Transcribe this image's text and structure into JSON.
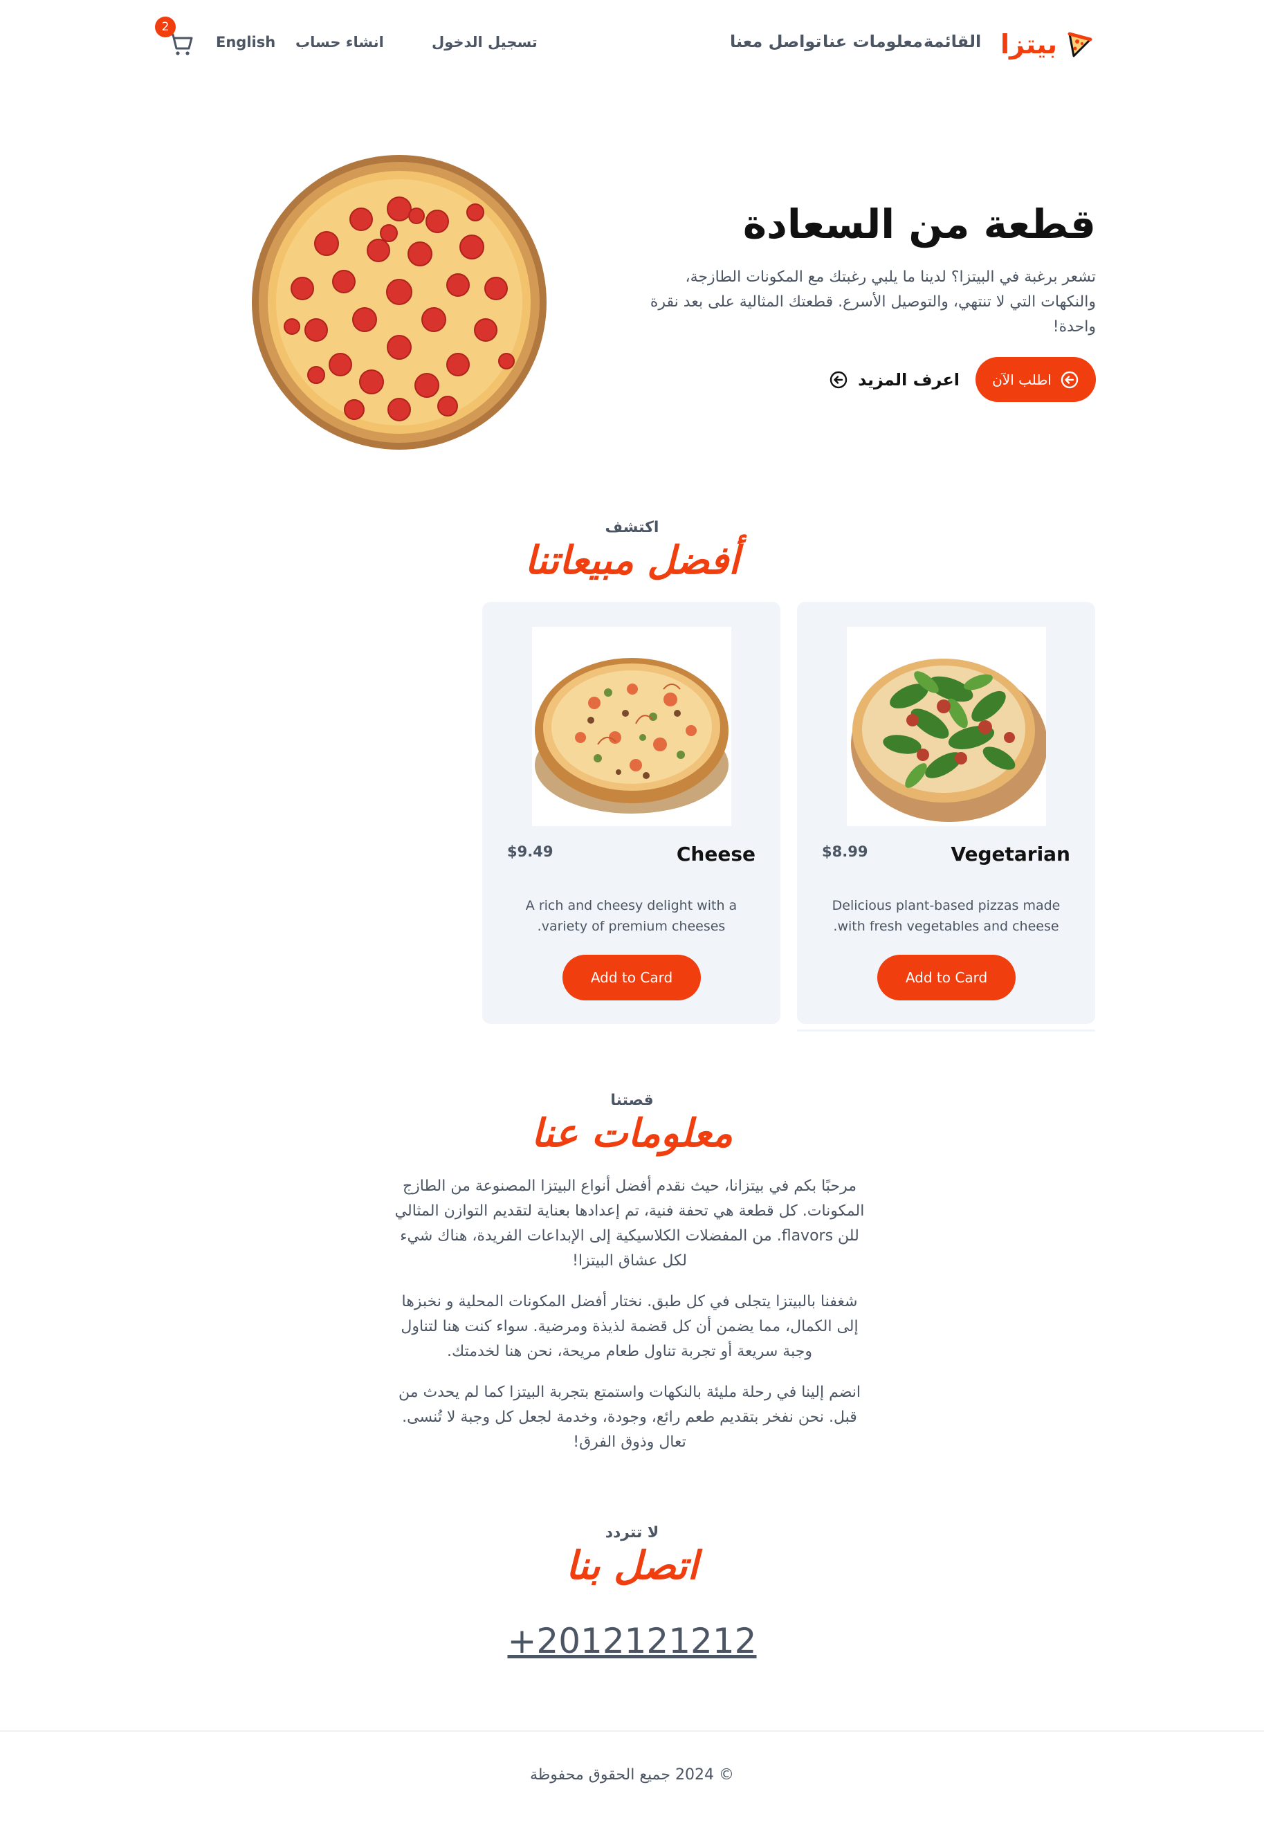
{
  "brand": {
    "name": "بيتزا",
    "logo_icon": "pizza-slice-icon",
    "accent_color": "#f03e0f"
  },
  "nav": {
    "menu": "القائمة",
    "about": "معلومات عنا",
    "contact": "تواصل معنا",
    "login": "تسجيل الدخول",
    "signup": "انشاء حساب",
    "language": "English",
    "cart_count": "2",
    "cart_icon": "shopping-cart-icon"
  },
  "hero": {
    "title": "قطعة من السعادة",
    "description": "تشعر برغبة في البيتزا؟ لدينا ما يلبي رغبتك مع المكونات الطازجة، والنكهات التي لا تنتهي، والتوصيل الأسرع. قطعتك المثالية على بعد نقرة واحدة!",
    "order_button": "اطلب الآن",
    "learn_more": "اعرف المزيد"
  },
  "bestsellers": {
    "eyebrow": "اكتشف",
    "title": "أفضل مبيعاتنا",
    "products": [
      {
        "name": "Vegetarian",
        "price": "$8.99",
        "description": "Delicious plant-based pizzas made with fresh vegetables and cheese.",
        "button": "Add to Card"
      },
      {
        "name": "Cheese",
        "price": "$9.49",
        "description": "A rich and cheesy delight with a variety of premium cheeses.",
        "button": "Add to Card"
      }
    ]
  },
  "about": {
    "eyebrow": "قصتنا",
    "title": "معلومات عنا",
    "paragraphs": [
      "مرحبًا بكم في بيتزانا، حيث نقدم أفضل أنواع البيتزا المصنوعة من الطازج المكونات. كل قطعة هي تحفة فنية، تم إعدادها بعناية لتقديم التوازن المثالي للن flavors. من المفضلات الكلاسيكية إلى الإبداعات الفريدة، هناك شيء لكل عشاق البيتزا!",
      "شغفنا بالبيتزا يتجلى في كل طبق. نختار أفضل المكونات المحلية و نخبزها إلى الكمال، مما يضمن أن كل قضمة لذيذة ومرضية. سواء كنت هنا لتناول وجبة سريعة أو تجربة تناول طعام مريحة، نحن هنا لخدمتك.",
      "انضم إلينا في رحلة مليئة بالنكهات واستمتع بتجربة البيتزا كما لم يحدث من قبل. نحن نفخر بتقديم طعم رائع، وجودة، وخدمة لجعل كل وجبة لا تُنسى. تعال وذوق الفرق!"
    ]
  },
  "contact": {
    "eyebrow": "لا تتردد",
    "title": "اتصل بنا",
    "phone": "+2012121212"
  },
  "footer": {
    "copyright": "© 2024 جميع الحقوق محفوظة"
  }
}
